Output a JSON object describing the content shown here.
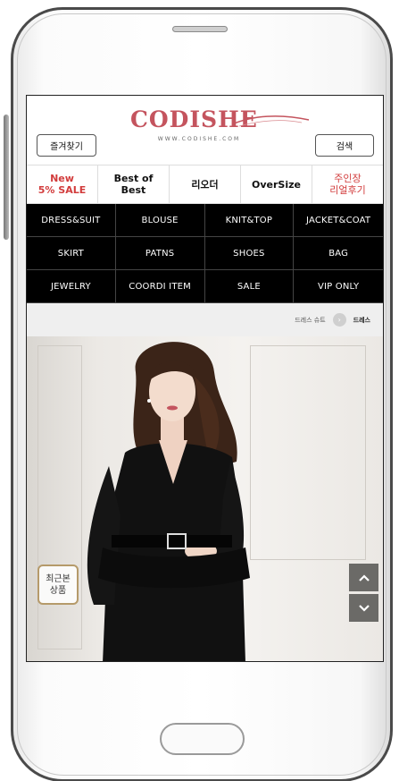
{
  "header": {
    "logo": "CODISHE",
    "logo_url": "WWW.CODISHE.COM",
    "bookmark_label": "즐겨찾기",
    "search_label": "검색"
  },
  "quick_menu": [
    {
      "line1": "New",
      "line2": "5% SALE"
    },
    {
      "line1": "Best of",
      "line2": "Best"
    },
    {
      "line1": "리오더",
      "line2": ""
    },
    {
      "line1": "OverSize",
      "line2": ""
    },
    {
      "line1": "주인장",
      "line2": "리얼후기"
    }
  ],
  "categories": [
    "DRESS&SUIT",
    "BLOUSE",
    "KNIT&TOP",
    "JACKET&COAT",
    "SKIRT",
    "PATNS",
    "SHOES",
    "BAG",
    "JEWELRY",
    "COORDI ITEM",
    "SALE",
    "VIP ONLY"
  ],
  "breadcrumb": {
    "parent": "드레스 슈트",
    "current": "드레스"
  },
  "recent": {
    "line1": "최근본",
    "line2": "상품"
  },
  "colors": {
    "brand": "#c4545e",
    "accent_red": "#d23c3c",
    "category_bg": "#000000",
    "scroll_button": "#6b6a67"
  },
  "icons": {
    "scroll_up": "chevron-up-icon",
    "scroll_down": "chevron-down-icon",
    "crumb_sep": "chevron-right-icon"
  }
}
